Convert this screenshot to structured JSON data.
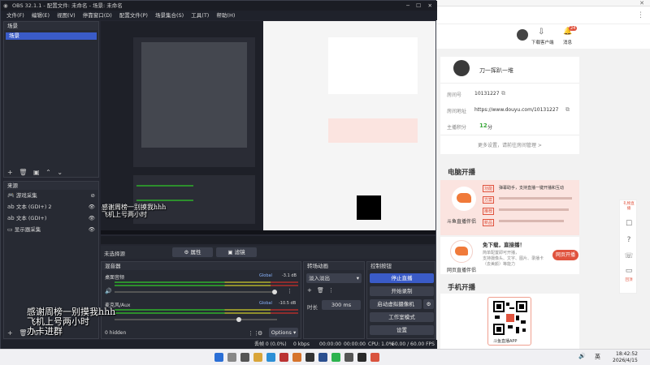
{
  "obs": {
    "title": "OBS 32.1.1 - 配置文件: 未命名 - 场景: 未命名",
    "menu": [
      "文件(F)",
      "编辑(E)",
      "视图(V)",
      "停靠窗口(D)",
      "配置文件(P)",
      "场景集合(S)",
      "工具(T)",
      "帮助(H)"
    ],
    "scenes": {
      "header": "场景",
      "items": [
        "场景"
      ]
    },
    "sources": {
      "header": "来源",
      "items": [
        "游戏采集",
        "文本 (GDI+) 2",
        "文本 (GDI+)",
        "显示器采集"
      ]
    },
    "preview_status": "未选择源",
    "properties_label": "属性",
    "filters_label": "滤镜",
    "mixer": {
      "header": "混音器",
      "channels": [
        {
          "name": "桌面音频",
          "badge": "Global",
          "db": "-3.1 dB"
        },
        {
          "name": "麦克风/Aux",
          "badge": "Global",
          "db": "-10.5 dB"
        }
      ],
      "hidden": "0 hidden",
      "options": "Options"
    },
    "transitions": {
      "header": "转场动画",
      "value": "淡入淡出",
      "duration_label": "时长",
      "duration": "300 ms"
    },
    "controls": {
      "header": "控制按钮",
      "buttons": [
        "停止直播",
        "开始录制",
        "启动虚拟摄像机",
        "工作室模式",
        "设置"
      ]
    },
    "statusbar": {
      "frames": "丢帧 0 (0.0%)",
      "kbps": "0 kbps",
      "time1": "00:00:00",
      "time2": "00:00:00",
      "cpu": "CPU: 1.0%",
      "fps": "60.00 / 60.00 FPS"
    }
  },
  "overlay_text": [
    "感谢周榜一别摸我hhh",
    "飞机上号两小时",
    "办卡进群"
  ],
  "web": {
    "header": {
      "download": "下载客户端",
      "messages": "消息",
      "badge": "24"
    },
    "profile": {
      "name": "刀一挥趴一堆",
      "room_id_label": "房间号",
      "room_id": "10131227",
      "room_url_label": "房间地址",
      "room_url": "https://www.douyu.com/10131227",
      "points_label": "主播积分",
      "points": "12",
      "points_unit": "分",
      "more": "更多设置，请前往房间管理 >"
    },
    "pc_title": "电脑开播",
    "pc_cards": [
      {
        "tags": [
          "功能",
          "方案",
          "推荐",
          "新品"
        ],
        "lines": [
          "弹幕助手，支持直播一键开播和互动",
          "",
          "",
          ""
        ],
        "label": "斗鱼直播伴侣"
      },
      {
        "lines": [
          "免下载，直接播！",
          "简单配置即可开播，",
          "支持摄像头、文字、图片、录播卡（去美颜）等能力"
        ],
        "label": "网页直播伴侣",
        "button": "网页开播"
      }
    ],
    "mobile_title": "手机开播",
    "qr_label": "斗鱼直播APP",
    "tools": [
      "礼物直播",
      "福利",
      "帮助",
      "客服",
      "反馈",
      "回顶"
    ]
  },
  "taskbar": {
    "lang": "英",
    "time": "18:42:52",
    "date": "2026/4/15"
  }
}
